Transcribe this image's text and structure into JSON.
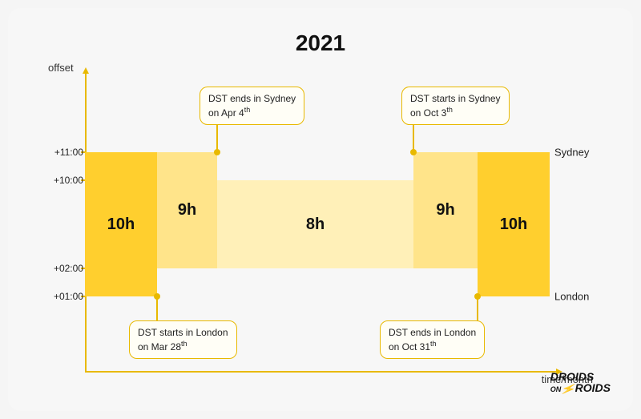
{
  "title": "2021",
  "axis": {
    "y": "offset",
    "x": "time/month"
  },
  "ticks": {
    "p11": "+11:00",
    "p10": "+10:00",
    "p02": "+02:00",
    "p01": "+01:00"
  },
  "cities": {
    "sydney": "Sydney",
    "london": "London"
  },
  "segments": {
    "s1": "10h",
    "s2": "9h",
    "s3": "8h",
    "s4": "9h",
    "s5": "10h"
  },
  "callouts": {
    "syd_end": "DST ends in Sydney<br>on Apr 4<sup>th</sup>",
    "syd_start": "DST starts in Sydney<br>on Oct 3<sup>th</sup>",
    "lon_start": "DST starts in London<br>on Mar 28<sup>th</sup>",
    "lon_end": "DST ends in London<br>on Oct 31<sup>th</sup>"
  },
  "logo": {
    "l1": "DROIDS",
    "mid": "ON",
    "l2": "ROIDS"
  },
  "chart_data": {
    "type": "bar",
    "title": "2021",
    "xlabel": "time/month",
    "ylabel": "offset",
    "y_ticks": [
      "+01:00",
      "+02:00",
      "+10:00",
      "+11:00"
    ],
    "series": [
      {
        "name": "Sydney",
        "segments": [
          {
            "from": "2021-01-01",
            "to": "2021-04-04",
            "offset": "+11:00"
          },
          {
            "from": "2021-04-04",
            "to": "2021-10-03",
            "offset": "+10:00"
          },
          {
            "from": "2021-10-03",
            "to": "2021-12-31",
            "offset": "+11:00"
          }
        ]
      },
      {
        "name": "London",
        "segments": [
          {
            "from": "2021-01-01",
            "to": "2021-03-28",
            "offset": "+01:00"
          },
          {
            "from": "2021-03-28",
            "to": "2021-10-31",
            "offset": "+02:00"
          },
          {
            "from": "2021-10-31",
            "to": "2021-12-31",
            "offset": "+01:00"
          }
        ]
      }
    ],
    "difference_segments": [
      {
        "label": "10h",
        "from": "2021-01-01",
        "to": "2021-03-28",
        "hours": 10
      },
      {
        "label": "9h",
        "from": "2021-03-28",
        "to": "2021-04-04",
        "hours": 9
      },
      {
        "label": "8h",
        "from": "2021-04-04",
        "to": "2021-10-03",
        "hours": 8
      },
      {
        "label": "9h",
        "from": "2021-10-03",
        "to": "2021-10-31",
        "hours": 9
      },
      {
        "label": "10h",
        "from": "2021-10-31",
        "to": "2021-12-31",
        "hours": 10
      }
    ],
    "annotations": [
      {
        "text": "DST ends in Sydney on Apr 4th",
        "x": "2021-04-04",
        "series": "Sydney"
      },
      {
        "text": "DST starts in Sydney on Oct 3th",
        "x": "2021-10-03",
        "series": "Sydney"
      },
      {
        "text": "DST starts in London on Mar 28th",
        "x": "2021-03-28",
        "series": "London"
      },
      {
        "text": "DST ends in London on Oct 31th",
        "x": "2021-10-31",
        "series": "London"
      }
    ]
  }
}
